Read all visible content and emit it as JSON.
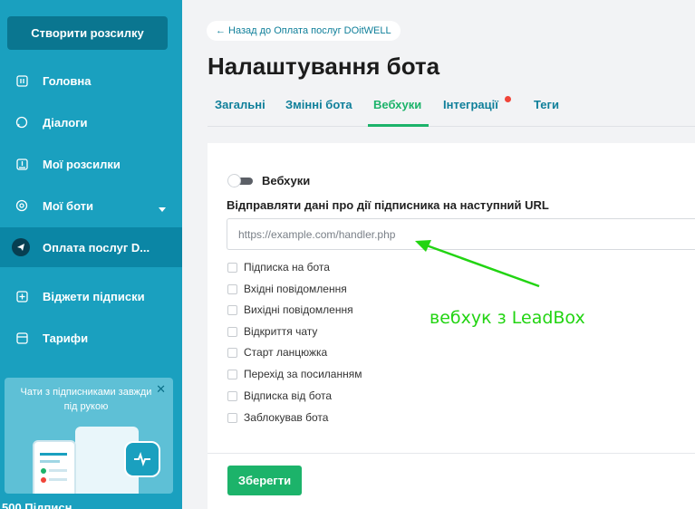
{
  "sidebar": {
    "create_button": "Створити розсилку",
    "items": [
      {
        "label": "Головна",
        "icon": "home-icon"
      },
      {
        "label": "Діалоги",
        "icon": "chat-icon"
      },
      {
        "label": "Мої розсилки",
        "icon": "broadcast-icon"
      },
      {
        "label": "Мої боти",
        "icon": "bots-icon"
      },
      {
        "label": "Оплата послуг D...",
        "icon": "telegram-icon"
      },
      {
        "label": "Віджети підписки",
        "icon": "widget-icon"
      },
      {
        "label": "Тарифи",
        "icon": "tariff-icon"
      }
    ],
    "promo_text": "Чати з підписниками завжди під рукою",
    "bottom_text": "500 Підписн..."
  },
  "back_link": "← Назад до Оплата послуг DOitWELL",
  "page_title": "Налаштування бота",
  "tabs": [
    "Загальні",
    "Змінні бота",
    "Вебхуки",
    "Інтеграції",
    "Теги"
  ],
  "active_tab": "Вебхуки",
  "webhook": {
    "toggle_label": "Вебхуки",
    "toggle_on": false,
    "url_label": "Відправляти дані про дії підписника на наступний URL",
    "url_placeholder": "https://example.com/handler.php",
    "url_value": "",
    "events": [
      "Підписка на бота",
      "Вхідні повідомлення",
      "Вихідні повідомлення",
      "Відкриття чату",
      "Старт ланцюжка",
      "Перехід за посиланням",
      "Відписка від бота",
      "Заблокував бота"
    ],
    "save_button": "Зберегти"
  },
  "annotation": "вебхук з LeadBox",
  "colors": {
    "sidebar": "#1aa0bf",
    "accent": "#1cb36a",
    "annotation": "#22d412"
  }
}
